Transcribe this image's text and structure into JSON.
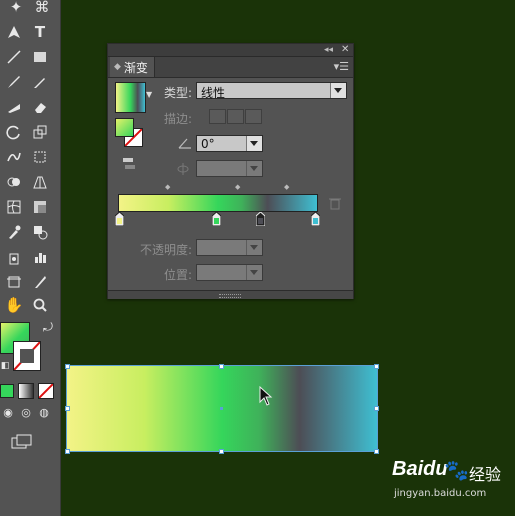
{
  "panel": {
    "tab_label": "渐变",
    "type_label": "类型:",
    "type_value": "线性",
    "stroke_label": "描边:",
    "angle_value": "0°",
    "opacity_label": "不透明度:",
    "location_label": "位置:"
  },
  "gradient": {
    "colors": [
      "#f3f387",
      "#c8ee60",
      "#35d65b",
      "#3fb15a",
      "#4d4d55",
      "#3fbfd2"
    ],
    "stops": [
      "#f3f387",
      "#35d65b",
      "#4d4d55",
      "#3fbfd2"
    ]
  },
  "watermark": {
    "brand": "Baidu",
    "brand_cn": "经验",
    "url": "jingyan.baidu.com"
  }
}
